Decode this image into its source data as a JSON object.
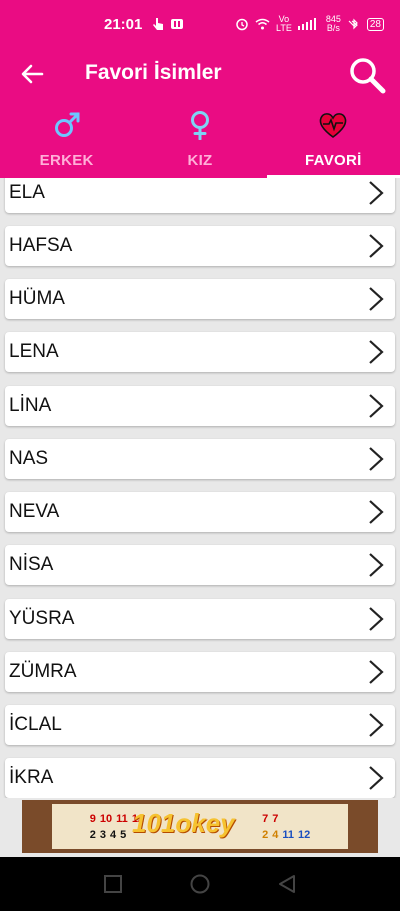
{
  "status_bar": {
    "time": "21:01",
    "left_icons": [
      "touch-icon",
      "app-notification-icon"
    ],
    "network_top": "845",
    "network_unit": "B/s",
    "volte_label": "Vo",
    "lte_label": "LTE",
    "battery": "28"
  },
  "app_bar": {
    "title": "Favori İsimler"
  },
  "tabs": [
    {
      "label": "ERKEK",
      "icon": "male-symbol-icon"
    },
    {
      "label": "KIZ",
      "icon": "female-symbol-icon"
    },
    {
      "label": "FAVORİ",
      "icon": "heart-pulse-icon"
    }
  ],
  "active_tab": "FAVORİ",
  "names": [
    "ELA",
    "HAFSA",
    "HÜMA",
    "LENA",
    "LİNA",
    "NAS",
    "NEVA",
    "NİSA",
    "YÜSRA",
    "ZÜMRA",
    "İCLAL",
    "İKRA"
  ],
  "ad": {
    "logo_text": "101okey",
    "tiles_top": [
      "9",
      "10",
      "11",
      "12",
      "7",
      "7"
    ],
    "tiles_bottom": [
      "2",
      "3",
      "4",
      "5",
      "2",
      "4",
      "11",
      "12"
    ]
  },
  "colors": {
    "brand": "#ea0c83",
    "male_icon": "#6ec6ff",
    "female_icon": "#7fd4f5",
    "heart_icon": "#e60039"
  }
}
